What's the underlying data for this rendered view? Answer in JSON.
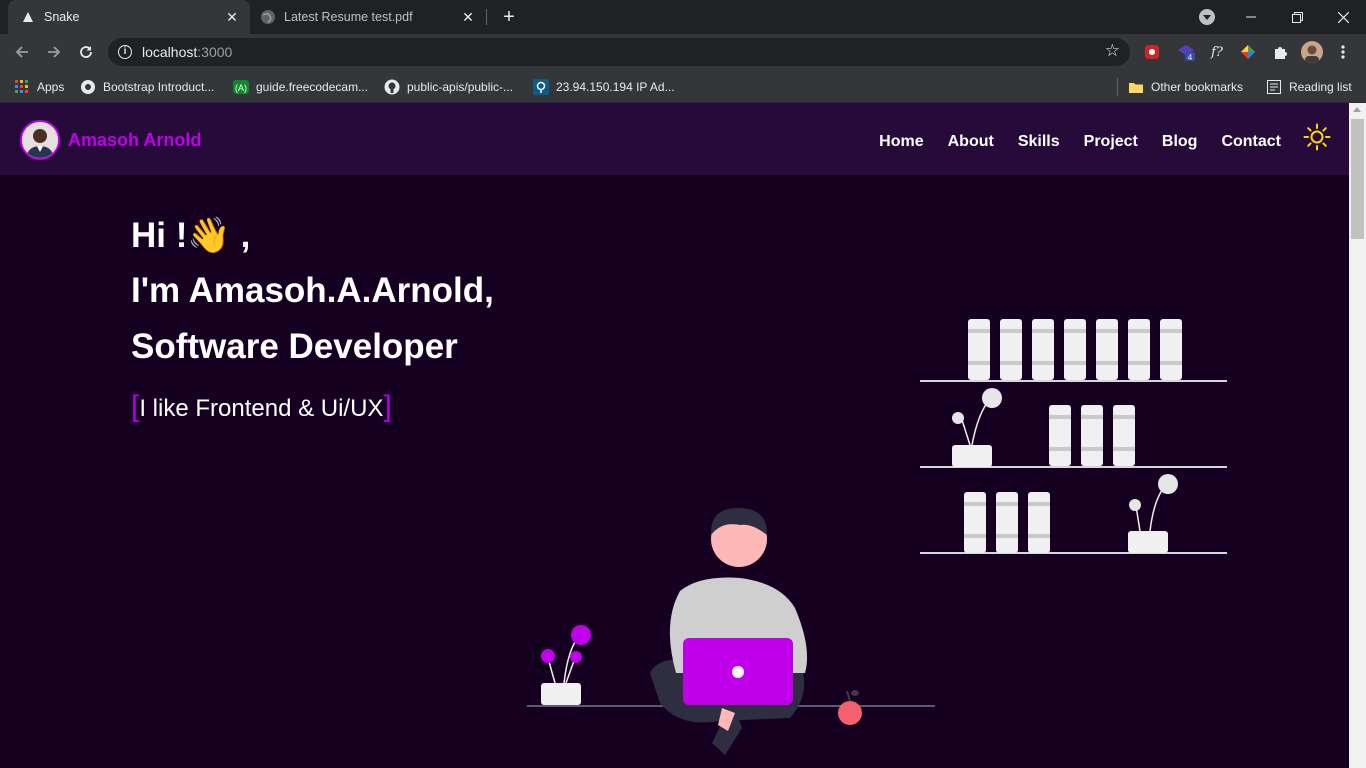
{
  "browser": {
    "tabs": [
      {
        "title": "Snake",
        "active": true
      },
      {
        "title": "Latest Resume test.pdf",
        "active": false
      }
    ],
    "address": {
      "host": "localhost",
      "port": ":3000"
    },
    "bookmarks": [
      {
        "label": "Apps",
        "icon": "apps-grid-icon"
      },
      {
        "label": "Bootstrap Introduct...",
        "icon": "globe-icon"
      },
      {
        "label": "guide.freecodecam...",
        "icon": "freecodecamp-icon"
      },
      {
        "label": "public-apis/public-...",
        "icon": "github-icon"
      },
      {
        "label": "23.94.150.194 IP Ad...",
        "icon": "location-icon"
      }
    ],
    "other_bookmarks": "Other bookmarks",
    "reading_list": "Reading list",
    "extension_badge": "4"
  },
  "site": {
    "brand": "Amasoh Arnold",
    "nav": [
      "Home",
      "About",
      "Skills",
      "Project",
      "Blog",
      "Contact"
    ],
    "hero": {
      "greeting": "Hi !👋 ,",
      "name_line": "I'm Amasoh.A.Arnold,",
      "role_line": "Software Developer",
      "tag_open": "[",
      "tagline": "I like Frontend & Ui/UX",
      "tag_close": "]"
    },
    "colors": {
      "accent": "#c000e8",
      "background": "#150022",
      "navbar": "#260a3a",
      "sun": "#ffd700"
    }
  }
}
